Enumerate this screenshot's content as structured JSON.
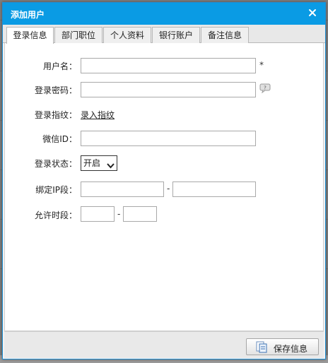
{
  "dialog": {
    "title": "添加用户",
    "close_icon": "close-icon"
  },
  "tabs": [
    {
      "label": "登录信息",
      "active": true
    },
    {
      "label": "部门职位",
      "active": false
    },
    {
      "label": "个人资料",
      "active": false
    },
    {
      "label": "银行账户",
      "active": false
    },
    {
      "label": "备注信息",
      "active": false
    }
  ],
  "form": {
    "username": {
      "label": "用户名：",
      "value": "",
      "required_mark": "*"
    },
    "password": {
      "label": "登录密码：",
      "value": "",
      "help_icon": "help-bubble-icon"
    },
    "fingerprint": {
      "label": "登录指纹：",
      "link": "录入指纹"
    },
    "wechat": {
      "label": "微信ID：",
      "value": ""
    },
    "status": {
      "label": "登录状态：",
      "selected": "开启"
    },
    "ip_range": {
      "label": "绑定IP段：",
      "from": "",
      "to": "",
      "separator": "-"
    },
    "time_range": {
      "label": "允许时段：",
      "from": "",
      "to": "",
      "separator": "-"
    }
  },
  "footer": {
    "save_label": "保存信息",
    "save_icon": "save-document-icon"
  },
  "colors": {
    "titlebar": "#0a9be4",
    "dialog_bg": "#f2f2f2"
  }
}
